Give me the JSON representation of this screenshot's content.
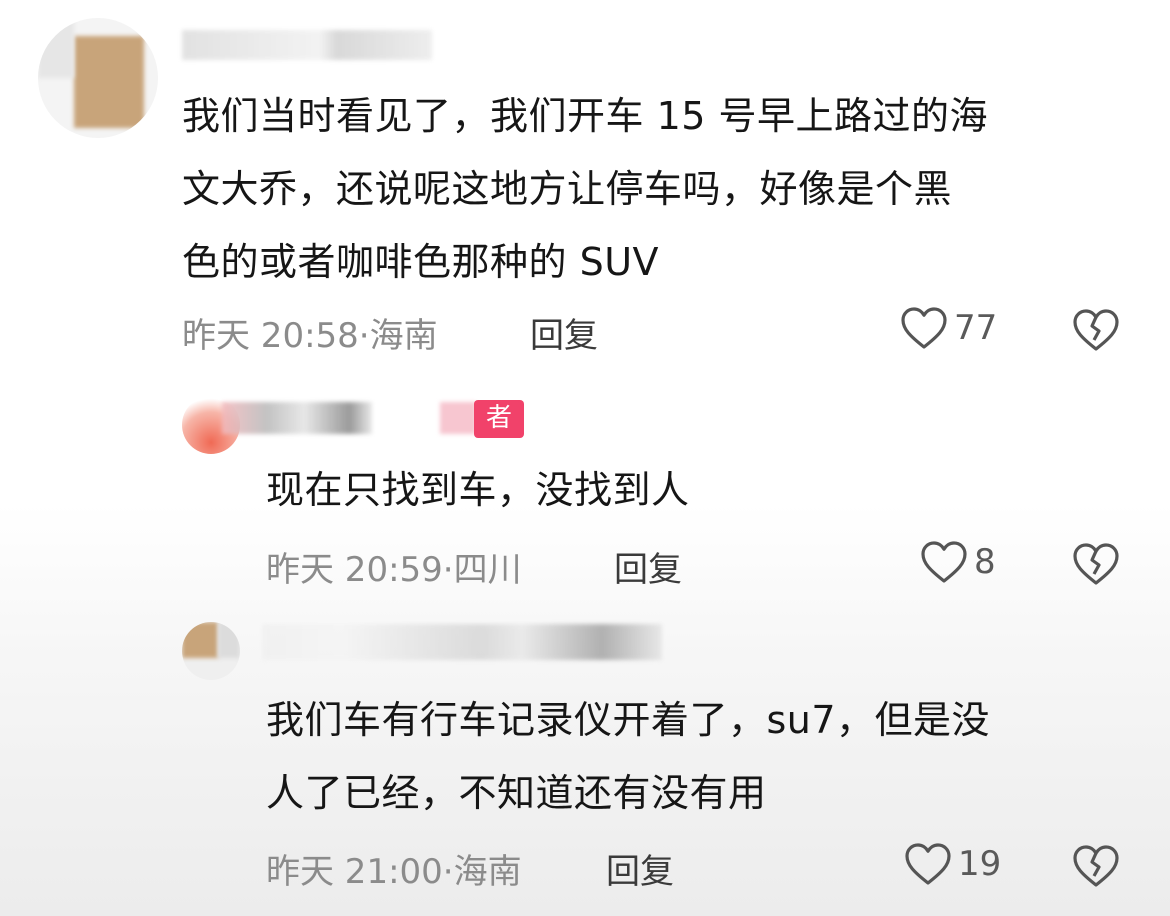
{
  "comments": [
    {
      "text_lines": [
        "我们当时看见了，我们开车 15 号早上路过的海",
        "文大乔，还说呢这地方让停车吗，好像是个黑",
        "色的或者咖啡色那种的 SUV"
      ],
      "time": "昨天 20:58",
      "location": "海南",
      "reply_label": "回复",
      "likes": "77",
      "like_icon": "heart-outline-icon",
      "dislike_icon": "broken-heart-icon"
    },
    {
      "badge": "者",
      "text_lines": [
        "现在只找到车，没找到人"
      ],
      "time": "昨天 20:59",
      "location": "四川",
      "reply_label": "回复",
      "likes": "8",
      "like_icon": "heart-outline-icon",
      "dislike_icon": "broken-heart-icon"
    },
    {
      "text_lines": [
        "我们车有行车记录仪开着了，su7，但是没",
        "人了已经，不知道还有没有用"
      ],
      "time": "昨天 21:00",
      "location": "海南",
      "reply_label": "回复",
      "likes": "19",
      "like_icon": "heart-outline-icon",
      "dislike_icon": "broken-heart-icon"
    }
  ],
  "colors": {
    "text": "#161616",
    "meta": "#8b8b8b",
    "badge": "#f1426a"
  }
}
